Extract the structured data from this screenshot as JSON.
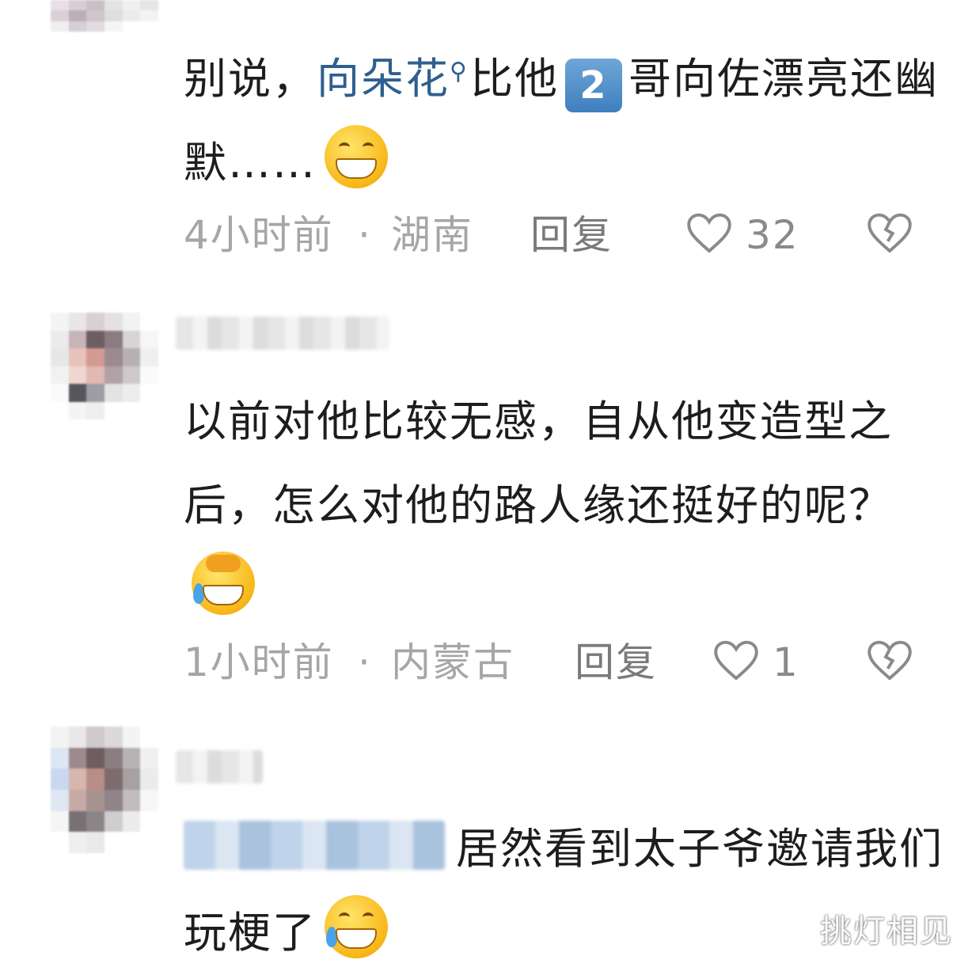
{
  "comments": [
    {
      "text_before": "别说，",
      "mention": "向朵花",
      "search_glyph": "🔍",
      "text_mid": "比他",
      "badge_number": "2",
      "text_after": "哥向佐漂亮还幽默……",
      "emoji": "grinning-emoji",
      "time": "4小时前",
      "location": "湖南",
      "reply": "回复",
      "likes": "32"
    },
    {
      "text": "以前对他比较无感，自从他变造型之后，怎么对他的路人缘还挺好的呢？",
      "emoji": "laughing-crying-emoji",
      "time": "1小时前",
      "location": "内蒙古",
      "reply": "回复",
      "likes": "1"
    },
    {
      "text": "居然看到太子爷邀请我们玩梗了",
      "emoji": "tears-of-joy-emoji"
    }
  ],
  "separator": "·",
  "watermark": "挑灯相见",
  "colors": {
    "mention": "#2e5f8f",
    "meta": "#a6a6a6",
    "badge": "#4a8ac6"
  }
}
